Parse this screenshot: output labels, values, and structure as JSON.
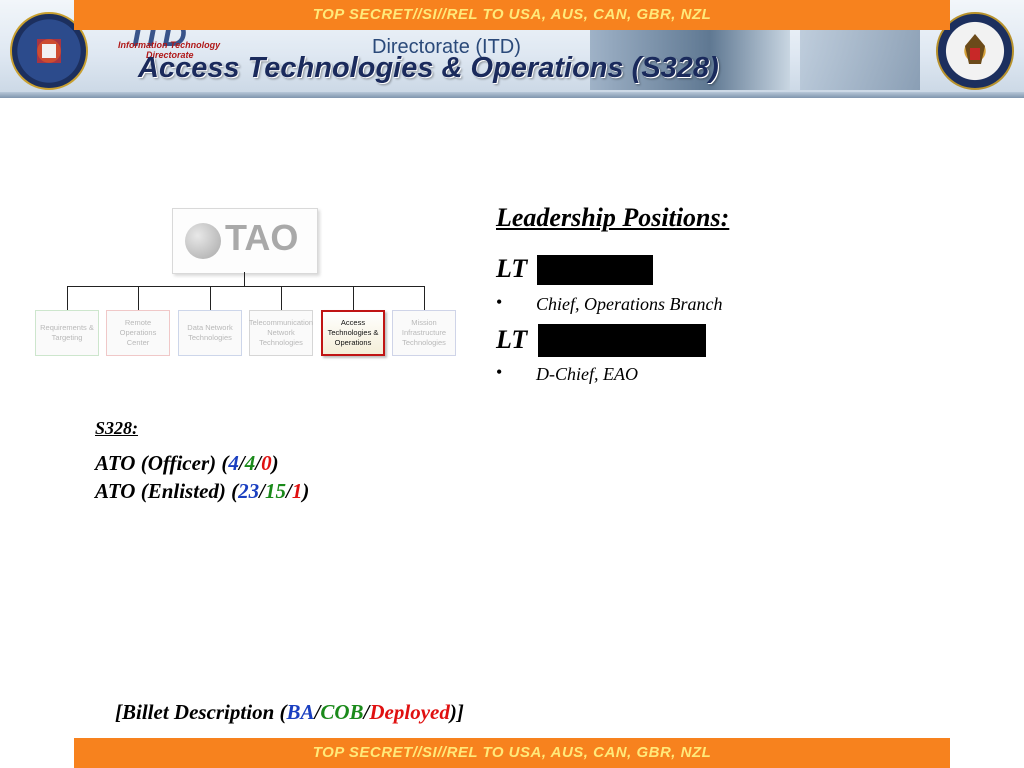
{
  "classification": {
    "top": "TOP SECRET//SI//REL TO USA, AUS, CAN, GBR, NZL",
    "bottom": "TOP SECRET//SI//REL TO USA, AUS, CAN, GBR, NZL"
  },
  "header": {
    "itd_logo_line1": "Information Technology",
    "itd_logo_line2": "Directorate",
    "directorate_text": "Directorate (ITD)",
    "title": "Access Technologies & Operations (S328)"
  },
  "org_chart": {
    "root": "TAO",
    "units": [
      {
        "label": "Requirements & Targeting",
        "active": false
      },
      {
        "label": "Remote Operations Center",
        "active": false
      },
      {
        "label": "Data Network Technologies",
        "active": false
      },
      {
        "label": "Telecommunication Network Technologies",
        "active": false
      },
      {
        "label": "Access Technologies & Operations",
        "active": true
      },
      {
        "label": "Mission Infrastructure Technologies",
        "active": false
      }
    ]
  },
  "leadership": {
    "title": "Leadership Positions:",
    "positions": [
      {
        "rank": "LT",
        "role": "Chief, Operations Branch"
      },
      {
        "rank": "LT",
        "role": "D-Chief, EAO"
      }
    ]
  },
  "manning": {
    "heading": "S328:",
    "rows": [
      {
        "label": "ATO (Officer) ",
        "ba": "4",
        "cob": "4",
        "deployed": "0"
      },
      {
        "label": "ATO (Enlisted) ",
        "ba": "23",
        "cob": "15",
        "deployed": "1"
      }
    ]
  },
  "billet_legend": {
    "prefix": "[Billet Description ",
    "ba": "BA",
    "cob": "COB",
    "deployed": "Deployed",
    "suffix": "]"
  },
  "colors": {
    "banner": "#f7821e",
    "banner_text": "#ffe97a",
    "ba": "#1a3fc0",
    "cob": "#1a8a1a",
    "deployed": "#e01010",
    "title": "#1a2a5c"
  }
}
